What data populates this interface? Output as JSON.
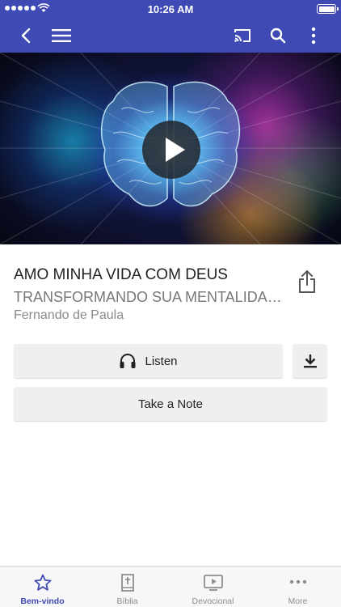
{
  "status_bar": {
    "time": "10:26 AM"
  },
  "nav": {
    "back_icon": "chevron-left-icon",
    "menu_icon": "hamburger-menu-icon",
    "cast_icon": "cast-icon",
    "search_icon": "search-icon",
    "more_icon": "more-vertical-icon",
    "background_color": "#3f4ab5"
  },
  "media": {
    "title": "AMO MINHA VIDA COM DEUS",
    "subtitle": "TRANSFORMANDO SUA MENTALIDADE",
    "speaker": "Fernando de Paula"
  },
  "actions": {
    "listen_label": "Listen",
    "take_note_label": "Take a Note"
  },
  "tabs": [
    {
      "label": "Bem-vindo",
      "icon": "star-icon",
      "active": true
    },
    {
      "label": "Bíblia",
      "icon": "bible-icon",
      "active": false
    },
    {
      "label": "Devocional",
      "icon": "video-icon",
      "active": false
    },
    {
      "label": "More",
      "icon": "more-horizontal-icon",
      "active": false
    }
  ],
  "colors": {
    "accent": "#3f4ab5",
    "inactive_tab": "#8e8e8e"
  }
}
